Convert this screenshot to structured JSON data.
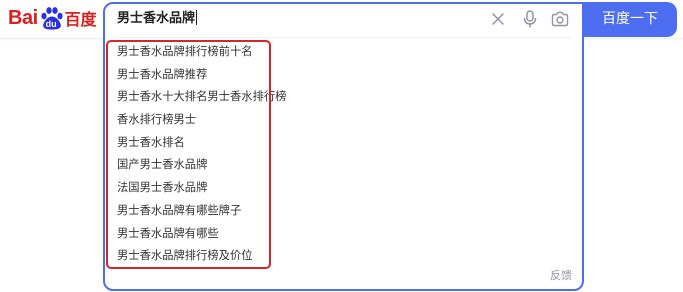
{
  "logo": {
    "bai": "Bai",
    "du": "du",
    "cn": "百度",
    "icon": "paw-icon"
  },
  "search": {
    "query": "男士香水品牌",
    "button_label": "百度一下",
    "icons": {
      "clear": "close-icon",
      "voice": "microphone-icon",
      "image": "camera-icon"
    }
  },
  "suggestions": [
    "男士香水品牌排行榜前十名",
    "男士香水品牌推荐",
    "男士香水十大排名男士香水排行榜",
    "香水排行榜男士",
    "男士香水排名",
    "国产男士香水品牌",
    "法国男士香水品牌",
    "男士香水品牌有哪些牌子",
    "男士香水品牌有哪些",
    "男士香水品牌排行榜及价位"
  ],
  "feedback_label": "反馈",
  "colors": {
    "brand_blue": "#4e6ef2",
    "logo_red": "#de1e1e",
    "highlight_red": "#d4262b",
    "icon_gray": "#9195a3"
  }
}
